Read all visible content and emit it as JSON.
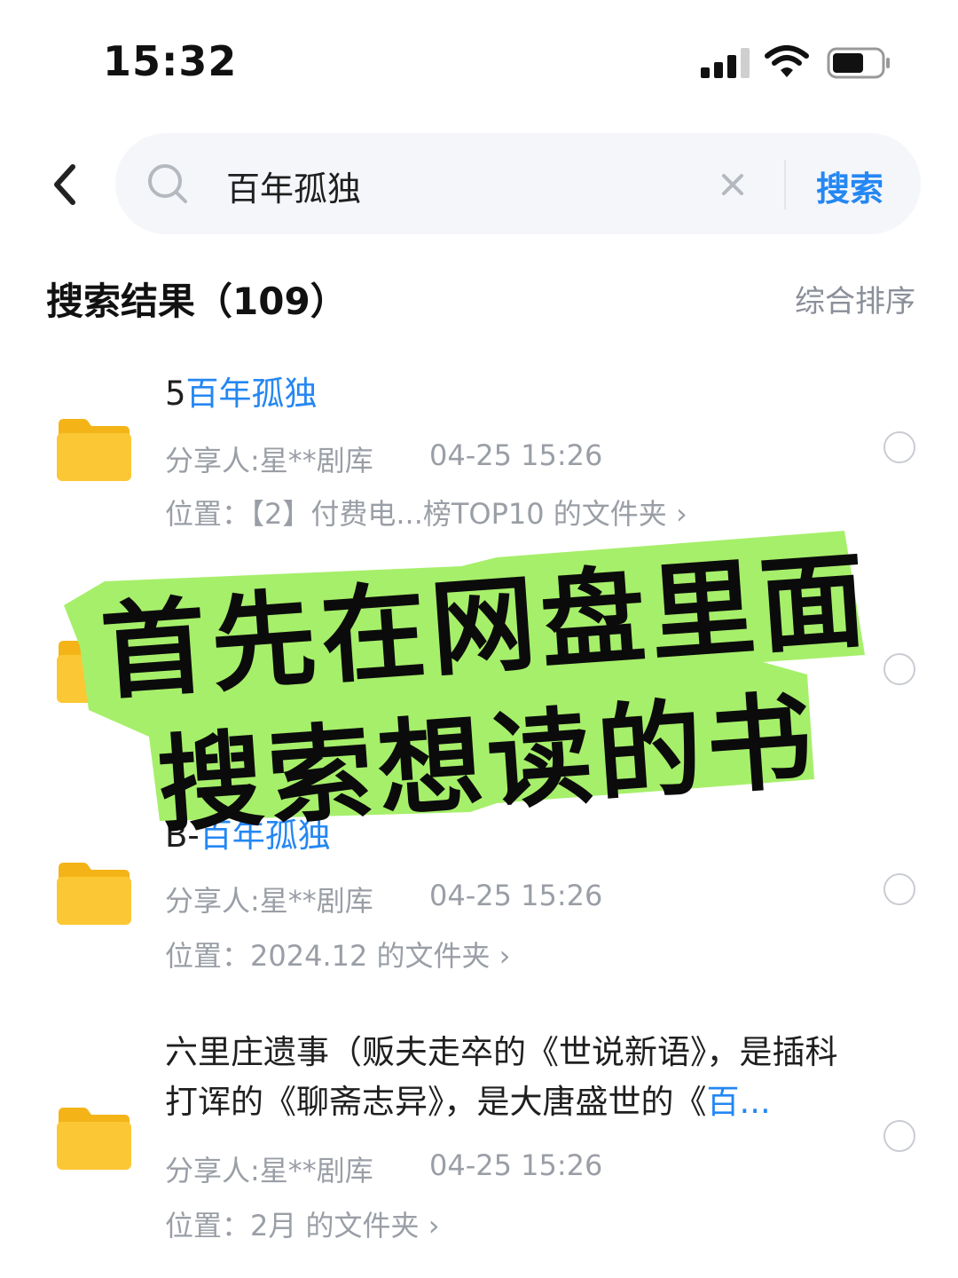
{
  "status_bar": {
    "time": "15:32"
  },
  "search": {
    "query": "百年孤独",
    "button_label": "搜索"
  },
  "results_header": {
    "title": "搜索结果（109）",
    "sort_label": "综合排序"
  },
  "results": [
    {
      "title_prefix": "5",
      "title_highlight": "百年孤独",
      "sharer": "分享人:星**剧库",
      "date": "04-25 15:26",
      "location": "位置：【2】付费电...榜TOP10 的文件夹 ›"
    },
    {
      "title_prefix": "B-",
      "title_highlight": "百年孤独",
      "sharer": "分享人:星**剧库",
      "date": "04-25 15:26",
      "location": "位置：2024.12 的文件夹 ›"
    },
    {
      "title_prefix": "六里庄遗事（贩夫走卒的《世说新语》，是插科打诨的《聊斋志异》，是大唐盛世的《",
      "title_highlight": "百...",
      "sharer": "分享人:星**剧库",
      "date": "04-25 15:26",
      "location": "位置：2月 的文件夹 ›"
    }
  ],
  "overlay": {
    "line1": "首先在网盘里面",
    "line2": "搜索想读的书",
    "highlight_color": "#a6ef6a"
  },
  "colors": {
    "accent": "#2487f3",
    "folder": "#fbc735"
  }
}
